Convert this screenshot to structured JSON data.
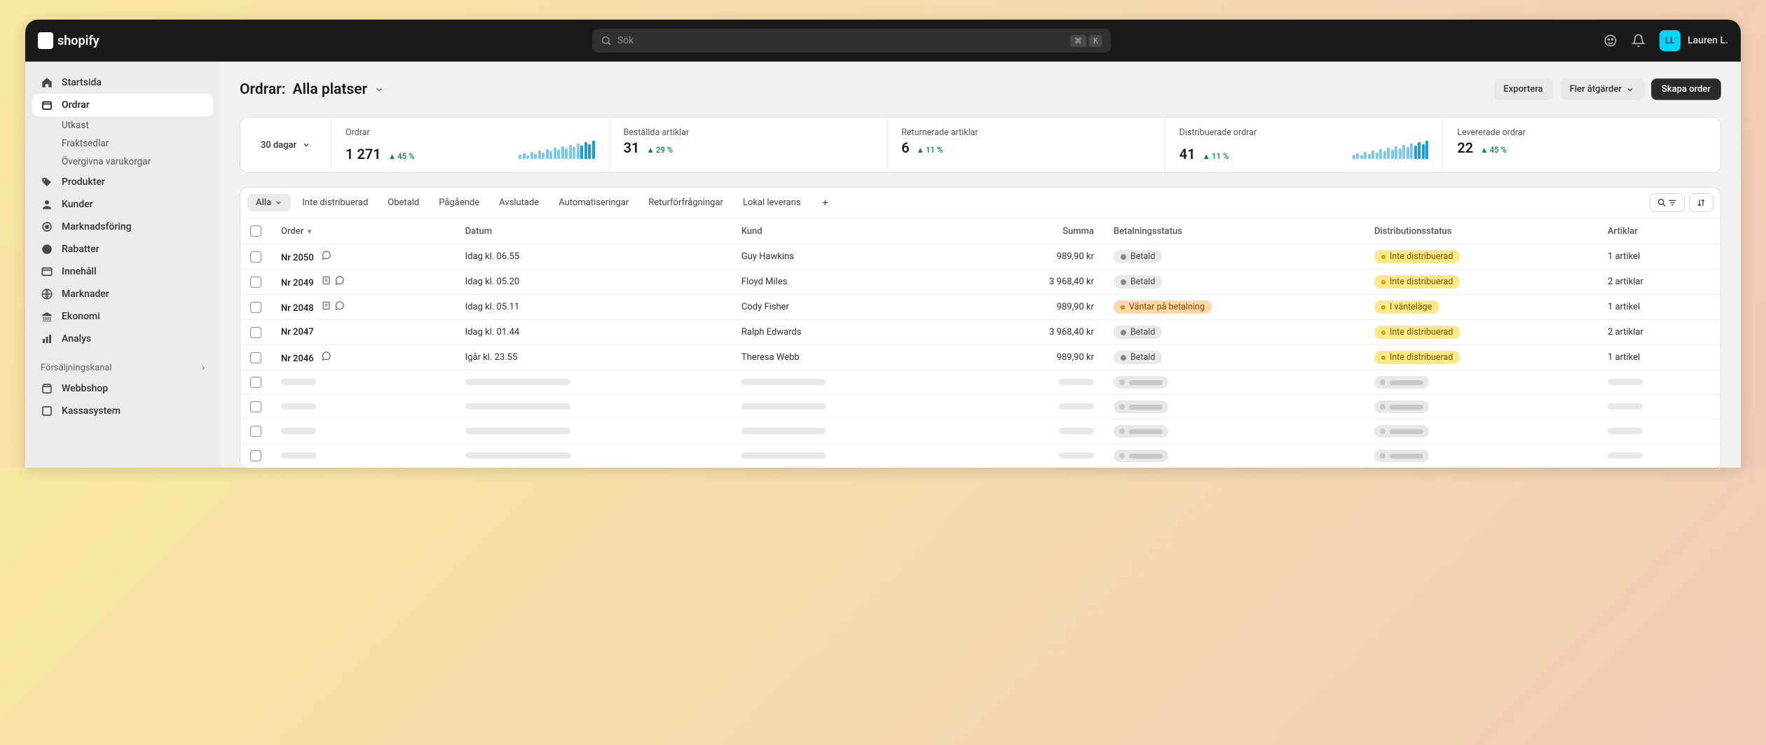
{
  "brand": "shopify",
  "search": {
    "placeholder": "Sök",
    "kbd1": "⌘",
    "kbd2": "K"
  },
  "user": {
    "initials": "LL",
    "name": "Lauren L."
  },
  "sidebar": {
    "home": "Startsida",
    "orders": "Ordrar",
    "subs": {
      "drafts": "Utkast",
      "shipping": "Fraktsedlar",
      "abandoned": "Övergivna varukorgar"
    },
    "products": "Produkter",
    "customers": "Kunder",
    "marketing": "Marknadsföring",
    "discounts": "Rabatter",
    "content": "Innehåll",
    "markets": "Marknader",
    "finance": "Ekonomi",
    "analytics": "Analys",
    "sales_channel_header": "Försäljningskanal",
    "online_store": "Webbshop",
    "pos": "Kassasystem"
  },
  "page": {
    "title": "Ordrar:",
    "location": "Alla platser",
    "actions": {
      "export": "Exportera",
      "more": "Fler åtgärder",
      "create": "Skapa order"
    }
  },
  "stats": {
    "period": "30 dagar",
    "items": [
      {
        "label": "Ordrar",
        "value": "1 271",
        "delta": "45 %",
        "spark": true
      },
      {
        "label": "Beställda artiklar",
        "value": "31",
        "delta": "29 %"
      },
      {
        "label": "Returnerade artiklar",
        "value": "6",
        "delta": "11 %"
      },
      {
        "label": "Distribuerade ordrar",
        "value": "41",
        "delta": "11 %",
        "spark": true
      },
      {
        "label": "Levererade ordrar",
        "value": "22",
        "delta": "45 %"
      }
    ]
  },
  "tabs": [
    "Alla",
    "Inte distribuerad",
    "Obetald",
    "Pågående",
    "Avslutade",
    "Automatiseringar",
    "Returförfrågningar",
    "Lokal leverans"
  ],
  "columns": {
    "order": "Order",
    "date": "Datum",
    "customer": "Kund",
    "total": "Summa",
    "payment": "Betalningsstatus",
    "fulfillment": "Distributionsstatus",
    "items": "Artiklar"
  },
  "badges": {
    "paid": "Betald",
    "pending_payment": "Väntar på betalning",
    "unfulfilled": "Inte distribuerad",
    "on_hold": "I vänteläge"
  },
  "rows": [
    {
      "order": "Nr 2050",
      "date": "Idag kl. 06.55",
      "customer": "Guy Hawkins",
      "total": "989,90 kr",
      "payment": "paid",
      "fulfillment": "unfulfilled",
      "items": "1 artikel",
      "icons": [
        "chat"
      ]
    },
    {
      "order": "Nr 2049",
      "date": "Idag kl. 05.20",
      "customer": "Floyd Miles",
      "total": "3 968,40 kr",
      "payment": "paid",
      "fulfillment": "unfulfilled",
      "items": "2 artiklar",
      "icons": [
        "note",
        "chat"
      ]
    },
    {
      "order": "Nr 2048",
      "date": "Idag kl. 05.11",
      "customer": "Cody Fisher",
      "total": "989,90 kr",
      "payment": "pending_payment",
      "fulfillment": "on_hold",
      "items": "1 artikel",
      "icons": [
        "note",
        "chat"
      ]
    },
    {
      "order": "Nr 2047",
      "date": "Idag kl. 01.44",
      "customer": "Ralph Edwards",
      "total": "3 968,40 kr",
      "payment": "paid",
      "fulfillment": "unfulfilled",
      "items": "2 artiklar",
      "icons": []
    },
    {
      "order": "Nr 2046",
      "date": "Igår kl. 23.55",
      "customer": "Theresa Webb",
      "total": "989,90 kr",
      "payment": "paid",
      "fulfillment": "unfulfilled",
      "items": "1 artikel",
      "icons": [
        "chat"
      ]
    }
  ],
  "skeleton_rows": 4
}
